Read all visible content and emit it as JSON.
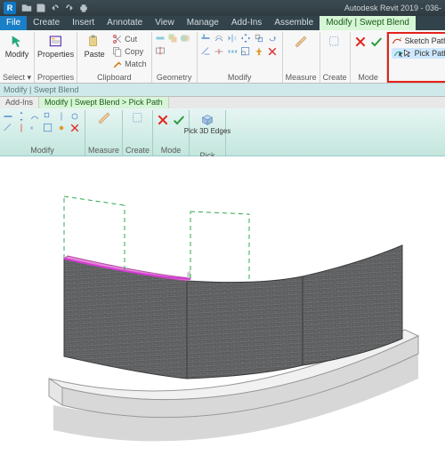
{
  "app": {
    "title": "Autodesk Revit 2019 - 036-"
  },
  "tabs": {
    "file": "File",
    "items": [
      "Create",
      "Insert",
      "Annotate",
      "View",
      "Manage",
      "Add-Ins",
      "Assemble"
    ],
    "context": "Modify | Swept Blend"
  },
  "ribbon": {
    "select": {
      "modify": "Modify",
      "title": "Select ▾"
    },
    "properties": {
      "label": "Properties",
      "title": "Properties"
    },
    "clipboard": {
      "paste": "Paste",
      "cut": "Cut",
      "copy": "Copy",
      "match": "Match",
      "title": "Clipboard"
    },
    "geometry": {
      "title": "Geometry"
    },
    "modify": {
      "title": "Modify"
    },
    "measure": {
      "title": "Measure"
    },
    "create": {
      "title": "Create"
    },
    "mode": {
      "title": "Mode"
    },
    "draw": {
      "sketch": "Sketch Path",
      "pick": "Pick Path"
    }
  },
  "context_strip": "Modify | Swept Blend",
  "subtabs": {
    "addins": "Add-Ins",
    "crumb": "Modify | Swept Blend > Pick Path"
  },
  "ribbon2": {
    "modify": "Modify",
    "measure": "Measure",
    "create": "Create",
    "mode": "Mode",
    "pick": "Pick",
    "pick3d": "Pick 3D\nEdges"
  }
}
